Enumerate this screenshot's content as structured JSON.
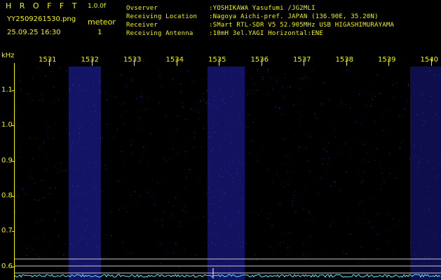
{
  "app": {
    "name": "H R O F F T",
    "version": "1.0.0f"
  },
  "file": {
    "name": "YY2509261530.png",
    "timestamp": "25.09.25 16:30"
  },
  "detection": {
    "label": "meteor",
    "count": "1"
  },
  "info": [
    {
      "label": "Ovserver",
      "value": ":YOSHIKAWA Yasufumi /JG2MLI"
    },
    {
      "label": "Receiving Location",
      "value": ":Nagoya Aichi-pref. JAPAN (136.90E, 35.20N)"
    },
    {
      "label": "Receiver",
      "value": ":SMart RTL-SDR V5 52.905MHz USB HIGASHIMURAYAMA"
    },
    {
      "label": "Receiving Antenna",
      "value": ":10mH 3el.YAGI Horizontal:ENE"
    }
  ],
  "axis": {
    "y_unit": "kHz",
    "y_ticks": [
      "1.1",
      "1.0",
      "0.9",
      "0.8",
      "0.7",
      "0.6"
    ],
    "x_ticks": [
      "1531",
      "1532",
      "1533",
      "1534",
      "1535",
      "1536",
      "1537",
      "1538",
      "1539",
      "1540"
    ]
  },
  "colors": {
    "text": "#f2f200",
    "background": "#000000",
    "noise": "#2a2ad8",
    "baseline": "#55e6ff"
  }
}
